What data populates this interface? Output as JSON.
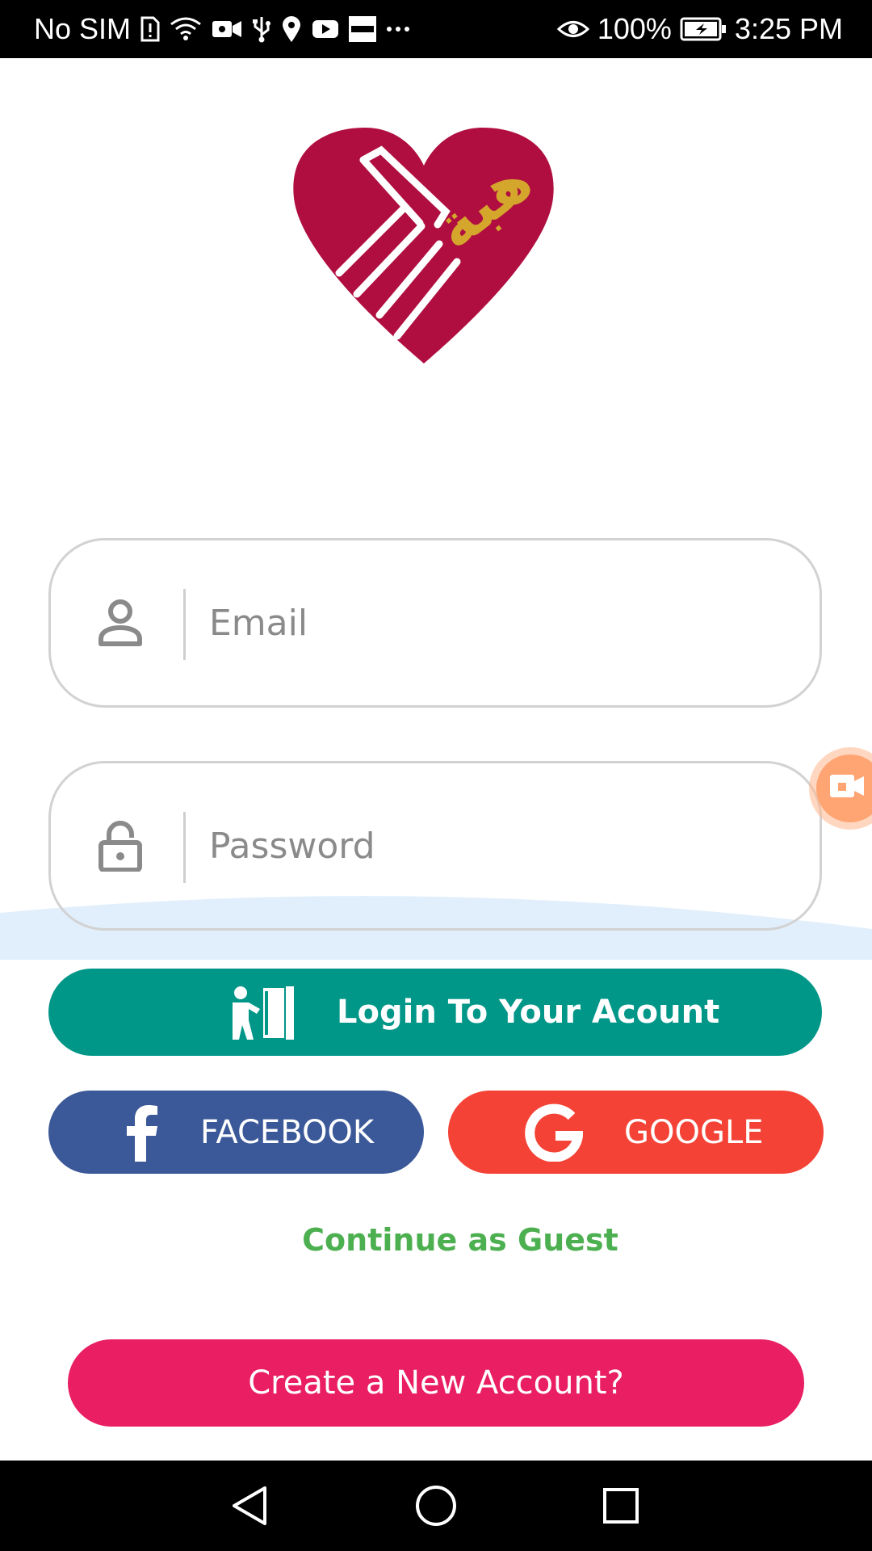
{
  "status_bar": {
    "carrier": "No SIM",
    "battery": "100%",
    "time": "3:25 PM",
    "notification_icons": [
      "sim-alert-icon",
      "wifi-icon",
      "video-icon",
      "usb-icon",
      "location-icon",
      "youtube-icon",
      "souq-icon",
      "more-dots-icon"
    ],
    "right_icons": [
      "eye-icon",
      "battery-icon"
    ]
  },
  "logo": {
    "brand_text": "هبة",
    "icon": "heart-hands-logo",
    "primary_color": "#b00e40",
    "accent_color": "#d4a72c"
  },
  "form": {
    "email": {
      "placeholder": "Email",
      "value": "",
      "icon": "user-icon"
    },
    "password": {
      "placeholder": "Password",
      "value": "",
      "icon": "lock-icon"
    }
  },
  "buttons": {
    "login": {
      "label": "Login To Your Acount",
      "icon": "door-exit-icon",
      "color": "#009688"
    },
    "facebook": {
      "label": "FACEBOOK",
      "icon": "facebook-icon",
      "color": "#3b5998"
    },
    "google": {
      "label": "GOOGLE",
      "icon": "google-icon",
      "color": "#f44336"
    },
    "guest": {
      "label": "Continue as Guest",
      "color": "#4caf50"
    },
    "create_account": {
      "label": "Create a New Account?",
      "color": "#e91e63"
    }
  },
  "floating_widget": {
    "icon": "screen-record-icon"
  },
  "nav_bar": {
    "items": [
      "back-icon",
      "home-icon",
      "recents-icon"
    ]
  }
}
